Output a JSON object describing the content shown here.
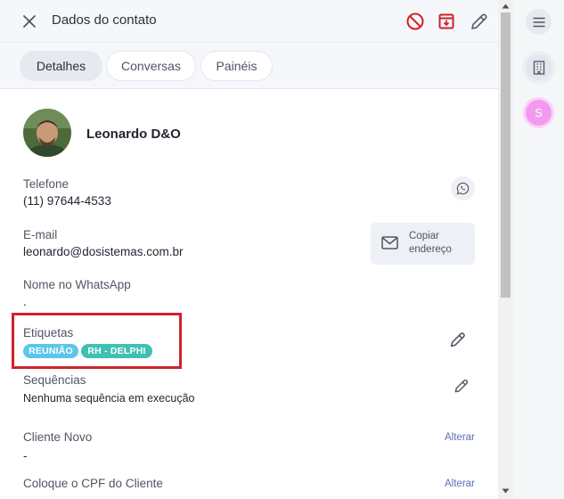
{
  "header": {
    "title": "Dados do contato",
    "icons": [
      "close-icon",
      "block-icon",
      "archive-icon",
      "pencil-icon"
    ],
    "accent_color": "#d0222b"
  },
  "tabs": [
    {
      "label": "Detalhes",
      "active": true
    },
    {
      "label": "Conversas",
      "active": false
    },
    {
      "label": "Painéis",
      "active": false
    }
  ],
  "contact": {
    "name": "Leonardo D&O"
  },
  "fields": {
    "telefone": {
      "label": "Telefone",
      "value": "(11) 97644-4533"
    },
    "email": {
      "label": "E-mail",
      "value": "leonardo@dosistemas.com.br",
      "copy_line1": "Copiar",
      "copy_line2": "endereço"
    },
    "whatsapp_name": {
      "label": "Nome no WhatsApp",
      "value": "."
    },
    "etiquetas": {
      "label": "Etiquetas",
      "tags": [
        {
          "text": "REUNIÃO",
          "color": "#5bc6ea"
        },
        {
          "text": "RH - DELPHI",
          "color": "#3fc0b3"
        }
      ]
    },
    "sequencias": {
      "label": "Sequências",
      "value": "Nenhuma sequência em execução"
    },
    "cliente_novo": {
      "label": "Cliente Novo",
      "value": "-",
      "action": "Alterar"
    },
    "cpf": {
      "label": "Coloque o CPF do Cliente",
      "action": "Alterar"
    }
  },
  "right_rail": {
    "items": [
      {
        "icon": "menu-icon"
      },
      {
        "icon": "building-icon"
      },
      {
        "initial": "S",
        "color": "#f39af0"
      }
    ]
  }
}
